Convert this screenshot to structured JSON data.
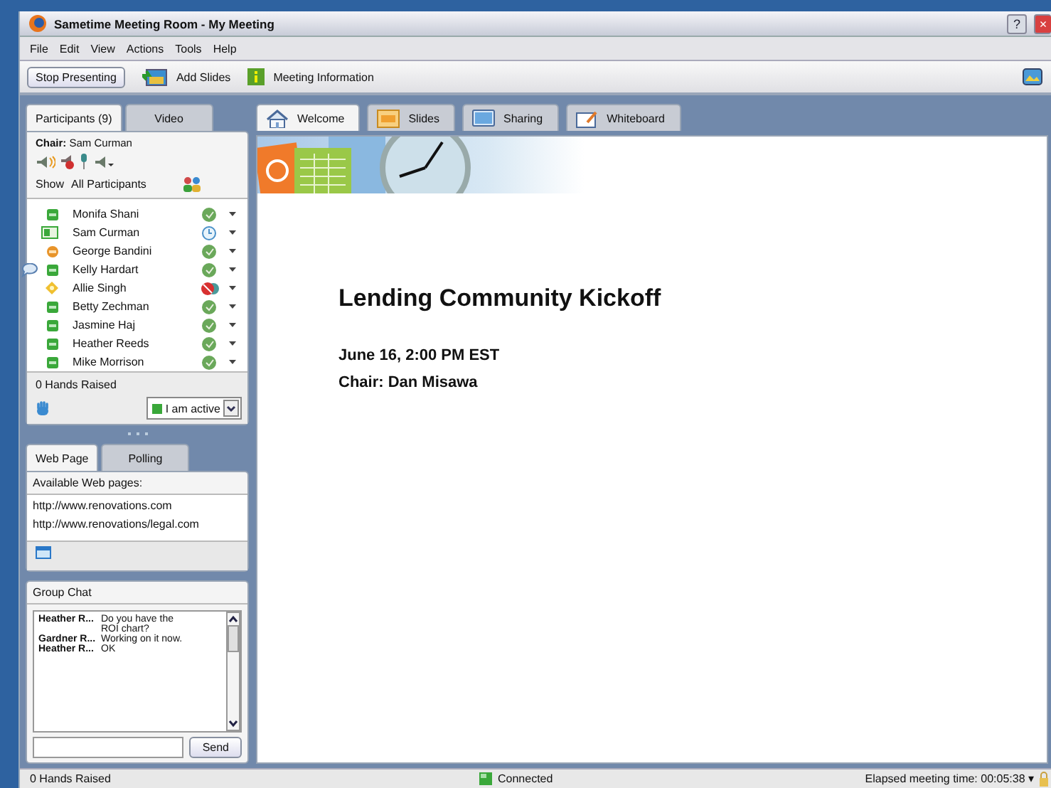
{
  "window": {
    "title": "Sametime Meeting Room - My Meeting",
    "help": "?",
    "close": "×"
  },
  "menu": [
    "File",
    "Edit",
    "View",
    "Actions",
    "Tools",
    "Help"
  ],
  "toolbar": {
    "stop_button": "Stop Presenting",
    "add_slides": "Add Slides",
    "meeting_info": "Meeting Information"
  },
  "left_tabs": [
    {
      "label": "Participants  (9)",
      "selected": true
    },
    {
      "label": "Video",
      "selected": false
    }
  ],
  "chair": {
    "label": "Chair:",
    "name": "Sam Curman"
  },
  "show": {
    "label": "Show",
    "value": "All Participants"
  },
  "participants": [
    {
      "name": "Monifa Shani",
      "kind": "active",
      "waiting": false,
      "blocked": false,
      "chatting": false
    },
    {
      "name": "Sam Curman",
      "kind": "presenter",
      "waiting": true,
      "blocked": false,
      "chatting": false
    },
    {
      "name": "George Bandini",
      "kind": "away",
      "waiting": false,
      "blocked": false,
      "chatting": false
    },
    {
      "name": "Kelly Hardart",
      "kind": "active",
      "waiting": false,
      "blocked": false,
      "chatting": true
    },
    {
      "name": "Allie Singh",
      "kind": "dnd",
      "waiting": false,
      "blocked": true,
      "chatting": false
    },
    {
      "name": "Betty Zechman",
      "kind": "active",
      "waiting": false,
      "blocked": false,
      "chatting": false
    },
    {
      "name": "Jasmine Haj",
      "kind": "active",
      "waiting": false,
      "blocked": false,
      "chatting": false
    },
    {
      "name": "Heather Reeds",
      "kind": "active",
      "waiting": false,
      "blocked": false,
      "chatting": false
    },
    {
      "name": "Mike Morrison",
      "kind": "active",
      "waiting": false,
      "blocked": false,
      "chatting": false
    }
  ],
  "hands_raised": "0 Hands Raised",
  "my_status": "I am active",
  "lower_tabs": [
    {
      "label": "Web Page",
      "selected": true
    },
    {
      "label": "Polling",
      "selected": false
    }
  ],
  "web_pages": {
    "label": "Available Web pages:",
    "urls": [
      "http://www.renovations.com",
      "http://www.renovations/legal.com"
    ]
  },
  "group_chat": {
    "title": "Group Chat",
    "messages": [
      {
        "sender": "Heather R...",
        "text": "Do you have the ROI chart?"
      },
      {
        "sender": "Gardner R...",
        "text": "Working on it now."
      },
      {
        "sender": "Heather R...",
        "text": "OK"
      }
    ],
    "send": "Send"
  },
  "main_tabs": [
    {
      "label": "Welcome",
      "selected": true,
      "kind": "welcome"
    },
    {
      "label": "Slides",
      "selected": false,
      "kind": "slides"
    },
    {
      "label": "Sharing",
      "selected": false,
      "kind": "sharing"
    },
    {
      "label": "Whiteboard",
      "selected": false,
      "kind": "whiteboard"
    }
  ],
  "welcome": {
    "heading": "Lending Community Kickoff",
    "date": "June 16, 2:00 PM EST",
    "chair": "Chair: Dan Misawa"
  },
  "status_bar": {
    "hands": "0 Hands Raised",
    "connection": "Connected",
    "elapsed": "Elapsed meeting time: 00:05:38 ▾"
  }
}
